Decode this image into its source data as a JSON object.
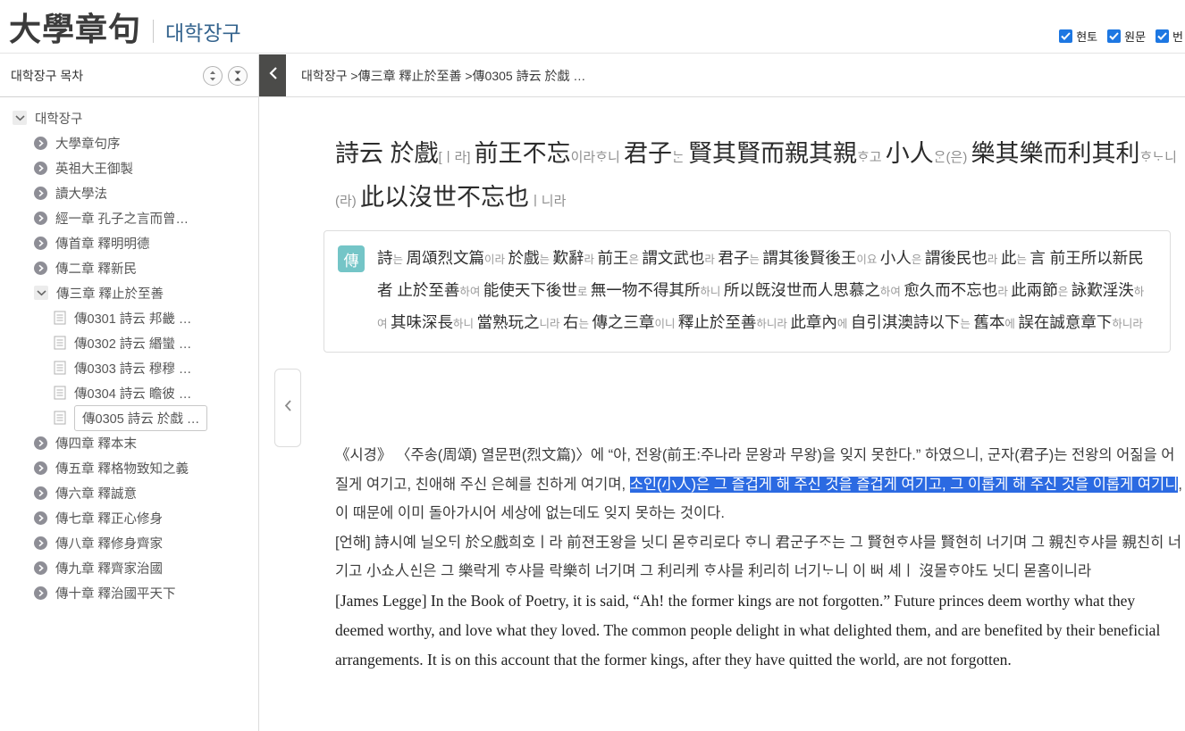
{
  "header": {
    "title_hanja": "大學章句",
    "title_korean": "대학장구",
    "toggles": [
      {
        "label": "현토",
        "checked": true
      },
      {
        "label": "원문",
        "checked": true
      },
      {
        "label": "번",
        "checked": true
      }
    ]
  },
  "sidebar": {
    "title": "대학장구 목차",
    "items": [
      {
        "label": "대학장구",
        "level": 0,
        "icon": "chevron-down",
        "expanded": true
      },
      {
        "label": "大學章句序",
        "level": 1,
        "icon": "circle-arrow"
      },
      {
        "label": "英祖大王御製",
        "level": 1,
        "icon": "circle-arrow"
      },
      {
        "label": "讀大學法",
        "level": 1,
        "icon": "circle-arrow"
      },
      {
        "label": "經一章 孔子之言而曾…",
        "level": 1,
        "icon": "circle-arrow"
      },
      {
        "label": "傳首章 釋明明德",
        "level": 1,
        "icon": "circle-arrow"
      },
      {
        "label": "傳二章 釋新民",
        "level": 1,
        "icon": "circle-arrow"
      },
      {
        "label": "傳三章 釋止於至善",
        "level": 1,
        "icon": "chevron-down",
        "expanded": true
      },
      {
        "label": "傳0301 詩云 邦畿 …",
        "level": 2,
        "icon": "doc"
      },
      {
        "label": "傳0302 詩云 緡蠻 …",
        "level": 2,
        "icon": "doc"
      },
      {
        "label": "傳0303 詩云 穆穆 …",
        "level": 2,
        "icon": "doc"
      },
      {
        "label": "傳0304 詩云 瞻彼 …",
        "level": 2,
        "icon": "doc"
      },
      {
        "label": "傳0305 詩云 於戱 …",
        "level": 2,
        "icon": "doc",
        "selected": true
      },
      {
        "label": "傳四章 釋本末",
        "level": 1,
        "icon": "circle-arrow"
      },
      {
        "label": "傳五章 釋格物致知之義",
        "level": 1,
        "icon": "circle-arrow"
      },
      {
        "label": "傳六章 釋誠意",
        "level": 1,
        "icon": "circle-arrow"
      },
      {
        "label": "傳七章 釋正心修身",
        "level": 1,
        "icon": "circle-arrow"
      },
      {
        "label": "傳八章 釋修身齊家",
        "level": 1,
        "icon": "circle-arrow"
      },
      {
        "label": "傳九章 釋齊家治國",
        "level": 1,
        "icon": "circle-arrow"
      },
      {
        "label": "傳十章 釋治國平天下",
        "level": 1,
        "icon": "circle-arrow"
      }
    ]
  },
  "breadcrumb": {
    "text": "대학장구 >傳三章 釋止於至善 >傳0305 詩云 於戱 …"
  },
  "passage": {
    "segments": [
      {
        "t": "m",
        "x": "詩云 於戲"
      },
      {
        "t": "a",
        "x": "[ㅣ라] "
      },
      {
        "t": "m",
        "x": "前王不忘"
      },
      {
        "t": "a",
        "x": "이라ᄒᆞ니 "
      },
      {
        "t": "m",
        "x": "君子"
      },
      {
        "t": "a",
        "x": "ᄂᆞᆫ "
      },
      {
        "t": "m",
        "x": "賢其賢而親其親"
      },
      {
        "t": "a",
        "x": "ᄒᆞ고 "
      },
      {
        "t": "m",
        "x": "小人"
      },
      {
        "t": "a",
        "x": "ᄋᆞᆫ(은) "
      },
      {
        "t": "m",
        "x": "樂其樂而利其利"
      },
      {
        "t": "a",
        "x": "ᄒᆞᄂᆞ니(라) "
      },
      {
        "t": "m",
        "x": "此以沒世不忘也"
      },
      {
        "t": "a",
        "x": "ㅣ니라"
      }
    ]
  },
  "commentary": {
    "badge": "傳",
    "segments": [
      {
        "t": "m",
        "x": "詩"
      },
      {
        "t": "a",
        "x": "는 "
      },
      {
        "t": "m",
        "x": "周頌烈文篇"
      },
      {
        "t": "a",
        "x": "이라 "
      },
      {
        "t": "m",
        "x": "於戲"
      },
      {
        "t": "a",
        "x": "는 "
      },
      {
        "t": "m",
        "x": "歎辭"
      },
      {
        "t": "a",
        "x": "라 "
      },
      {
        "t": "m",
        "x": "前王"
      },
      {
        "t": "a",
        "x": "은 "
      },
      {
        "t": "m",
        "x": "謂文武也"
      },
      {
        "t": "a",
        "x": "라 "
      },
      {
        "t": "m",
        "x": "君子"
      },
      {
        "t": "a",
        "x": "는 "
      },
      {
        "t": "m",
        "x": "謂其後賢後王"
      },
      {
        "t": "a",
        "x": "이요 "
      },
      {
        "t": "m",
        "x": "小人"
      },
      {
        "t": "a",
        "x": "은 "
      },
      {
        "t": "m",
        "x": "謂後民也"
      },
      {
        "t": "a",
        "x": "라 "
      },
      {
        "t": "m",
        "x": "此"
      },
      {
        "t": "a",
        "x": "는 "
      },
      {
        "t": "m",
        "x": "言 前王所以新民者 止於至善"
      },
      {
        "t": "a",
        "x": "하여 "
      },
      {
        "t": "m",
        "x": "能使天下後世"
      },
      {
        "t": "a",
        "x": "로 "
      },
      {
        "t": "m",
        "x": "無一物不得其所"
      },
      {
        "t": "a",
        "x": "하니 "
      },
      {
        "t": "m",
        "x": "所以旣沒世而人思慕之"
      },
      {
        "t": "a",
        "x": "하여 "
      },
      {
        "t": "m",
        "x": "愈久而不忘也"
      },
      {
        "t": "a",
        "x": "라 "
      },
      {
        "t": "m",
        "x": "此兩節"
      },
      {
        "t": "a",
        "x": "은 "
      },
      {
        "t": "m",
        "x": "詠歎淫泆"
      },
      {
        "t": "a",
        "x": "하여 "
      },
      {
        "t": "m",
        "x": "其味深長"
      },
      {
        "t": "a",
        "x": "하니 "
      },
      {
        "t": "m",
        "x": "當熟玩之"
      },
      {
        "t": "a",
        "x": "니라 "
      },
      {
        "t": "m",
        "x": "右"
      },
      {
        "t": "a",
        "x": "는 "
      },
      {
        "t": "m",
        "x": "傳之三章"
      },
      {
        "t": "a",
        "x": "이니 "
      },
      {
        "t": "m",
        "x": "釋止於至善"
      },
      {
        "t": "a",
        "x": "하니라 "
      },
      {
        "t": "m",
        "x": "此章內"
      },
      {
        "t": "a",
        "x": "에 "
      },
      {
        "t": "m",
        "x": "自引淇澳詩以下"
      },
      {
        "t": "a",
        "x": "는 "
      },
      {
        "t": "m",
        "x": "舊本"
      },
      {
        "t": "a",
        "x": "에 "
      },
      {
        "t": "m",
        "x": "誤在誠意章下"
      },
      {
        "t": "a",
        "x": "하니라"
      }
    ]
  },
  "translation": {
    "korean_segments": [
      {
        "t": "normal",
        "x": "《시경》 〈주송(周頌) 열문편(烈文篇)〉에 “아, 전왕(前王:주나라 문왕과 무왕)을 잊지 못한다.” 하였으니, 군자(君子)는 전왕의 어짊을 어질게 여기고, 친애해 주신 은혜를 친하게 여기며, "
      },
      {
        "t": "highlight",
        "x": "소인(小人)은 그 즐겁게 해 주신 것을 즐겁게 여기고, 그 이롭게 해 주신 것을 이롭게 여기니"
      },
      {
        "t": "normal",
        "x": ", 이 때문에 이미 돌아가시어 세상에 없는데도 잊지 못하는 것이다."
      }
    ],
    "eonhae": "[언해] 詩시예 닐오ᄃᆡ 於오戲희호ㅣ라 前젼王왕을 닛디 몯ᄒᆞ리로다 ᄒᆞ니 君군子ᄌᆞ는 그 賢현ᄒᆞ샤믈 賢현히 너기며 그 親친ᄒᆞ샤믈 親친히 너기고 小쇼人ᅀᅵᆫ은 그 樂락게 ᄒᆞ샤믈 락樂히 너기며 그 利리케 ᄒᆞ샤믈 利리히 너기ᄂᆞ니 이 ᄡᅥ 셰ㅣ 沒몰ᄒᆞ야도 닛디 몯홈이니라",
    "legge": "[James Legge] In the Book of Poetry, it is said, “Ah! the former kings are not forgotten.” Future princes deem worthy what they deemed worthy, and love what they loved. The common people delight in what delighted them, and are benefited by their beneficial arrangements. It is on this account that the former kings, after they have quitted the world, are not forgotten."
  },
  "colors": {
    "accent_teal": "#74c5c7",
    "highlight_blue": "#2b6ae2",
    "checkbox_blue": "#1d77e2",
    "korean_title_blue": "#35648e",
    "back_button_charcoal": "#4b4b49"
  }
}
